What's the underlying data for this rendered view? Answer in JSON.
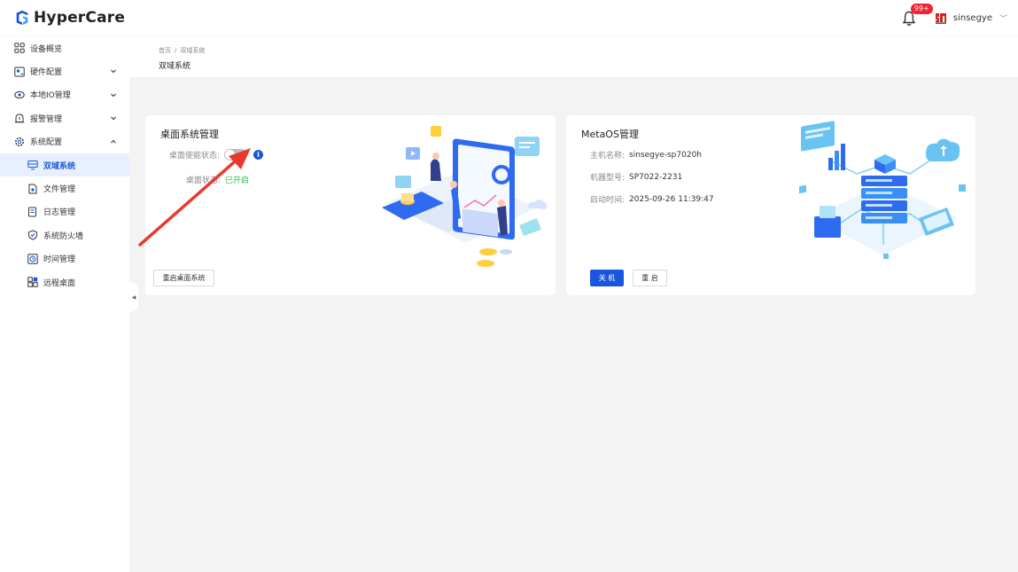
{
  "app": {
    "name": "HyperCare"
  },
  "header": {
    "notification_badge": "99+",
    "username": "sinsegye"
  },
  "sidebar": {
    "items": [
      {
        "label": "设备概览"
      },
      {
        "label": "硬件配置"
      },
      {
        "label": "本地IO管理"
      },
      {
        "label": "报警管理"
      },
      {
        "label": "系统配置"
      }
    ],
    "sub_items": [
      {
        "label": "双域系统"
      },
      {
        "label": "文件管理"
      },
      {
        "label": "日志管理"
      },
      {
        "label": "系统防火墙"
      },
      {
        "label": "时间管理"
      },
      {
        "label": "远程桌面"
      }
    ]
  },
  "breadcrumb": {
    "home": "首页",
    "separator": "/",
    "current": "双域系统"
  },
  "page": {
    "title": "双域系统"
  },
  "desktop_card": {
    "title": "桌面系统管理",
    "enable_label": "桌面使能状态:",
    "enabled": false,
    "status_label": "桌面状态:",
    "status_value": "已开启",
    "restart_button": "重启桌面系统"
  },
  "metaos_card": {
    "title": "MetaOS管理",
    "host_label": "主机名称:",
    "host_value": "sinsegye-sp7020h",
    "model_label": "机器型号:",
    "model_value": "SP7022-2231",
    "boot_label": "启动时间:",
    "boot_value": "2025-09-26 11:39:47",
    "shutdown_button": "关 机",
    "reboot_button": "重 启"
  },
  "colors": {
    "primary": "#1a56db",
    "active_bg": "#e8f0ff",
    "status_green": "#2dbe4a",
    "badge_red": "#f5222d",
    "annotation_red": "#e8392f"
  },
  "icons": {
    "bell": "bell-icon",
    "menu": [
      "grid-icon",
      "hardware-icon",
      "io-icon",
      "alarm-icon",
      "settings-icon"
    ],
    "sub": [
      "dual-domain-icon",
      "file-icon",
      "log-icon",
      "firewall-icon",
      "clock-icon",
      "remote-desktop-icon"
    ]
  }
}
